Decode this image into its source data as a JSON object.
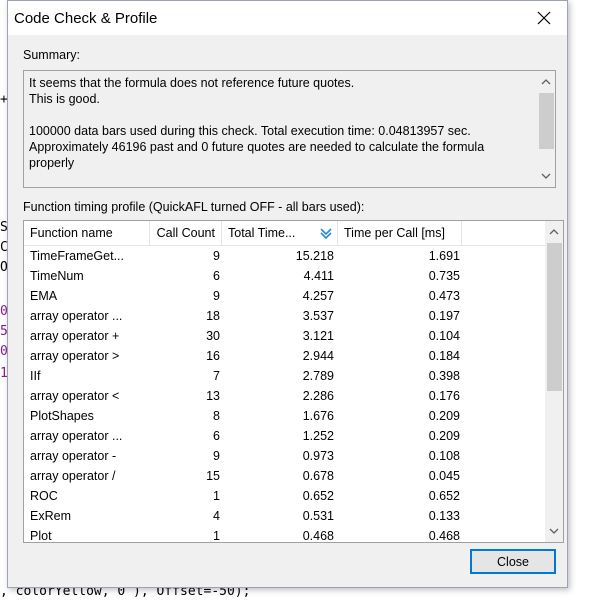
{
  "dialog": {
    "title": "Code Check & Profile",
    "summary_label": "Summary:",
    "summary_lines": [
      "It seems that the formula does not reference future quotes.",
      "This is good.",
      "",
      "100000 data bars used during this check. Total execution time: 0.04813957 sec.",
      "Approximately 46196 past and 0 future quotes are needed to calculate the formula",
      "properly"
    ],
    "profile_label": "Function timing profile (QuickAFL turned OFF - all bars used):",
    "close_label": "Close"
  },
  "table": {
    "columns": [
      "Function name",
      "Call Count",
      "Total Time...",
      "Time per Call [ms]"
    ],
    "sorted_column_icon": "sort-descending-icon",
    "rows": [
      [
        "TimeFrameGet...",
        "9",
        "15.218",
        "1.691"
      ],
      [
        "TimeNum",
        "6",
        "4.411",
        "0.735"
      ],
      [
        "EMA",
        "9",
        "4.257",
        "0.473"
      ],
      [
        "array operator ...",
        "18",
        "3.537",
        "0.197"
      ],
      [
        "array operator +",
        "30",
        "3.121",
        "0.104"
      ],
      [
        "array operator >",
        "16",
        "2.944",
        "0.184"
      ],
      [
        "IIf",
        "7",
        "2.789",
        "0.398"
      ],
      [
        "array operator <",
        "13",
        "2.286",
        "0.176"
      ],
      [
        "PlotShapes",
        "8",
        "1.676",
        "0.209"
      ],
      [
        "array operator ...",
        "6",
        "1.252",
        "0.209"
      ],
      [
        "array operator -",
        "9",
        "0.973",
        "0.108"
      ],
      [
        "array operator /",
        "15",
        "0.678",
        "0.045"
      ],
      [
        "ROC",
        "1",
        "0.652",
        "0.652"
      ],
      [
        "ExRem",
        "4",
        "0.531",
        "0.133"
      ],
      [
        "Plot",
        "1",
        "0.468",
        "0.468"
      ]
    ]
  },
  "background": {
    "left_chars": [
      "+",
      "",
      "",
      "",
      "",
      "S",
      "C",
      "O",
      "",
      "0",
      "5",
      "0",
      "1"
    ],
    "bottom_line": ", colorYellow, 0 ), Offset=-50);"
  },
  "colors": {
    "accent": "#0078d7",
    "code_purple": "#8b1a8b"
  }
}
